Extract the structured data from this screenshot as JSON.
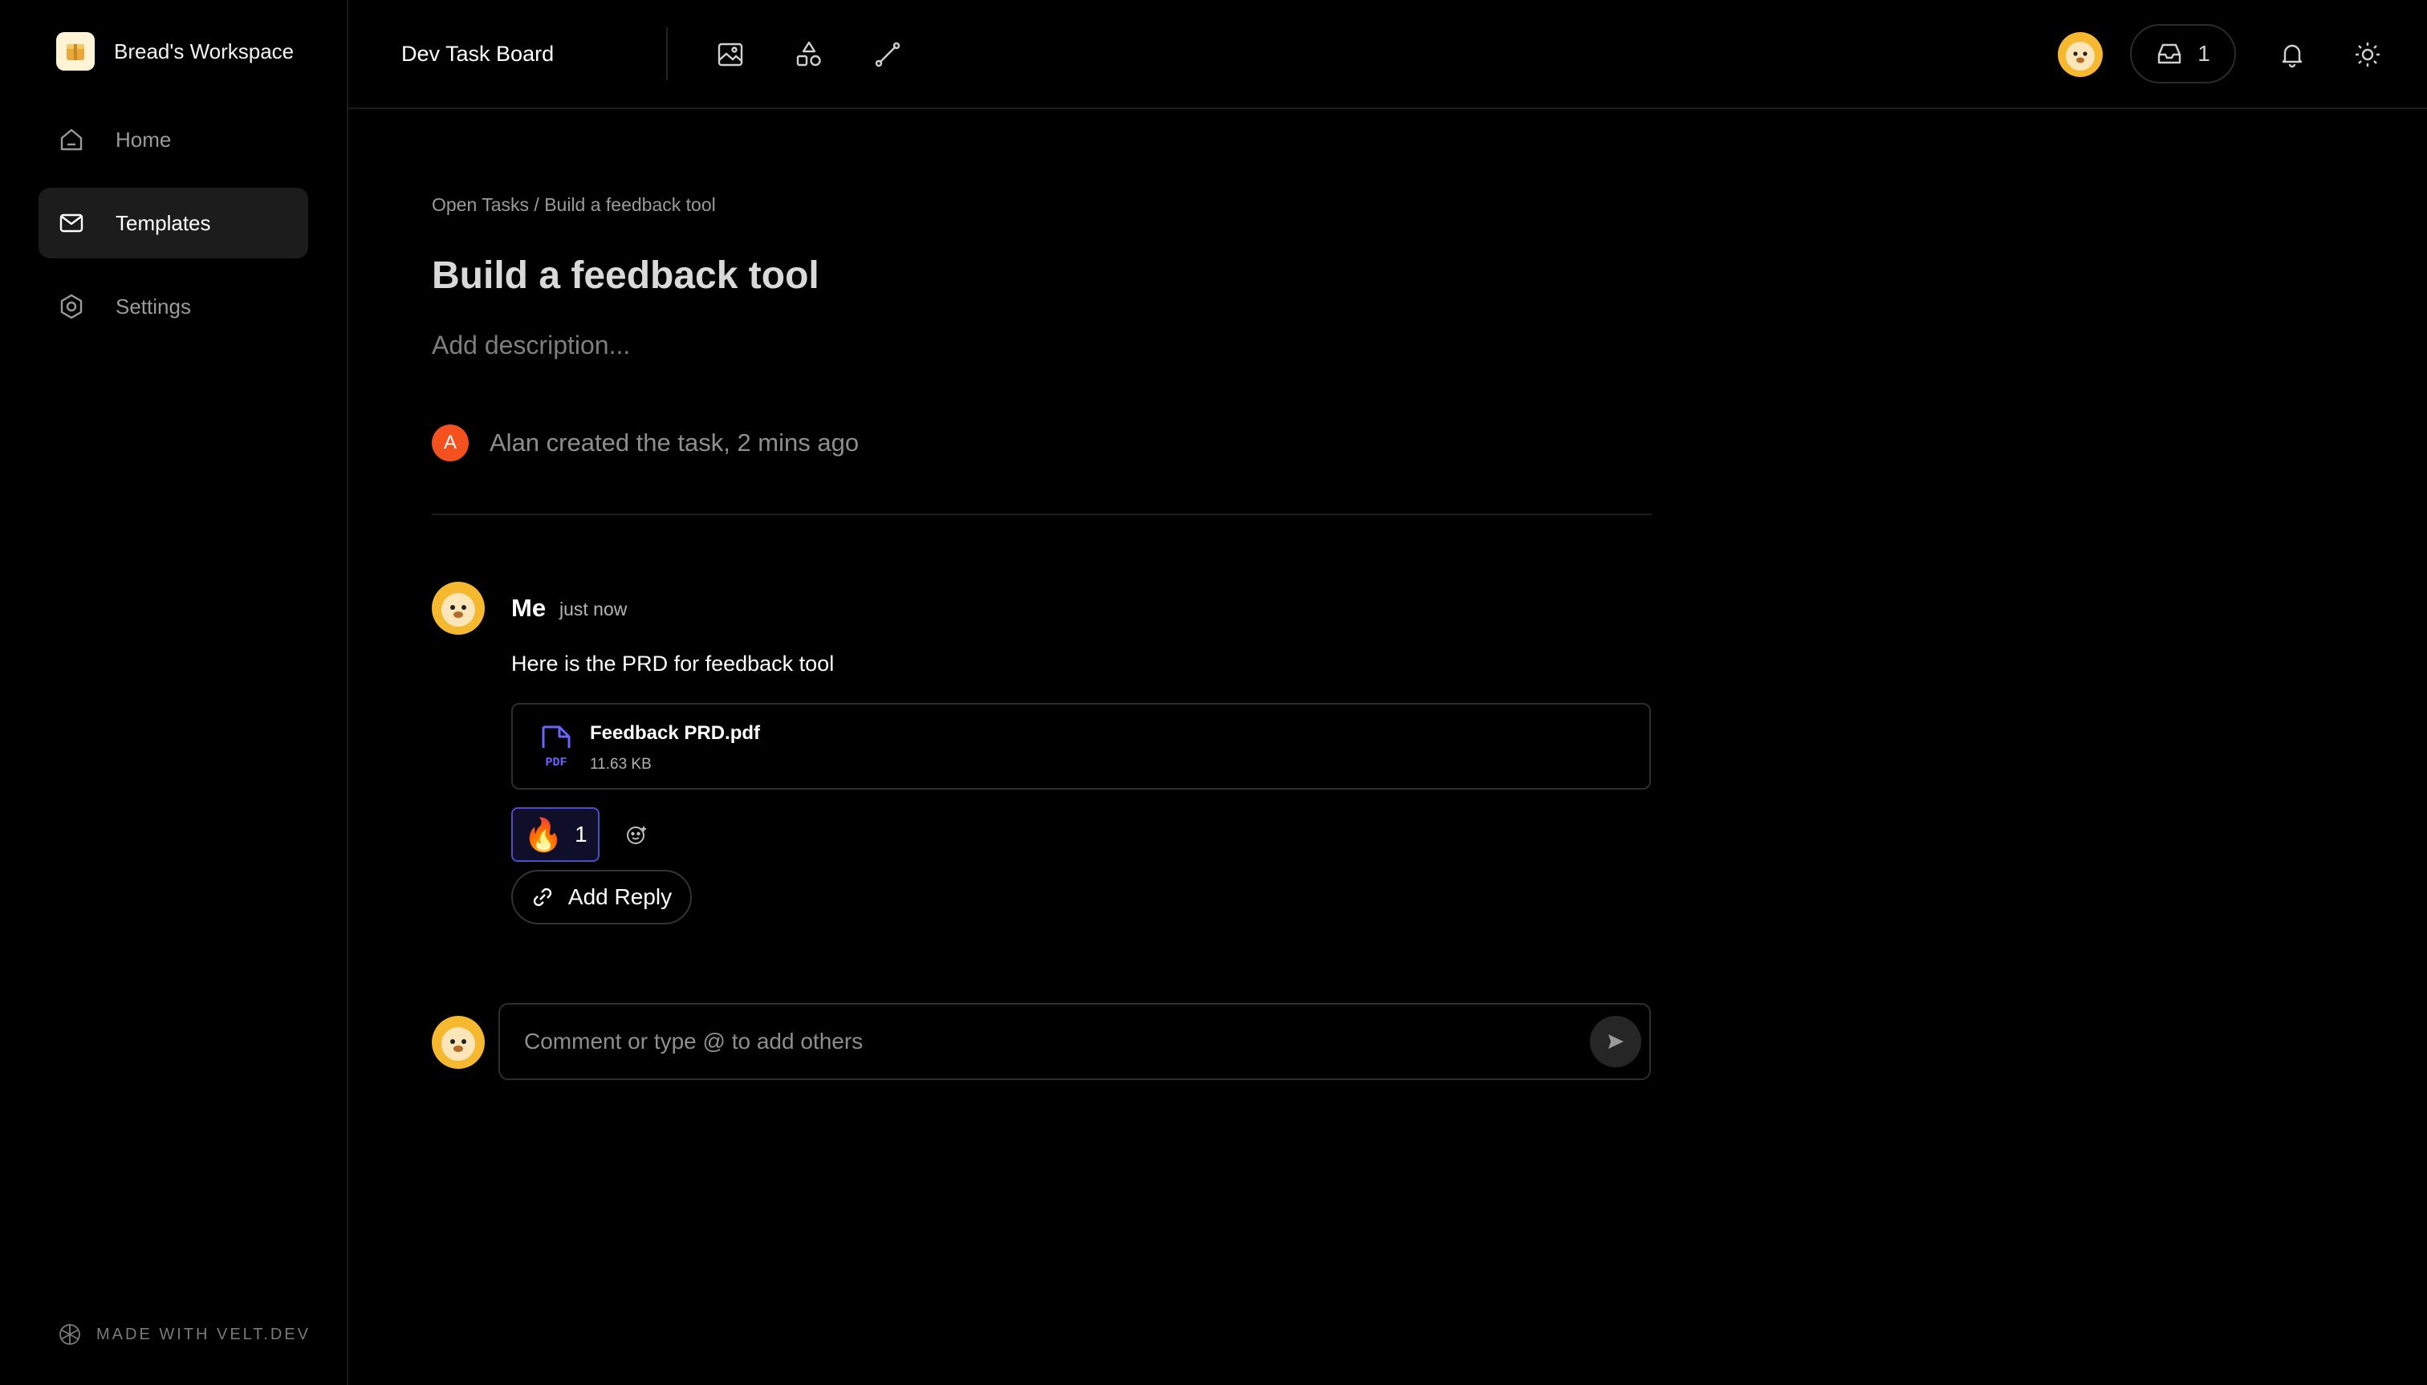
{
  "workspace": {
    "name": "Bread's Workspace"
  },
  "sidebar": {
    "items": [
      {
        "label": "Home",
        "icon": "home-icon"
      },
      {
        "label": "Templates",
        "icon": "mail-icon",
        "active": true
      },
      {
        "label": "Settings",
        "icon": "settings-icon"
      }
    ],
    "footer": "MADE WITH VELT.DEV"
  },
  "header": {
    "board_title": "Dev Task Board",
    "tools": [
      "image-icon",
      "shapes-icon",
      "line-icon"
    ],
    "inbox_count": "1",
    "icons": [
      "bell-icon",
      "sun-icon"
    ]
  },
  "task": {
    "breadcrumb": "Open Tasks / Build a feedback tool",
    "title": "Build a feedback tool",
    "description_placeholder": "Add description...",
    "activity": {
      "avatar_initial": "A",
      "text": "Alan created the task, 2 mins ago"
    }
  },
  "comment": {
    "author": "Me",
    "time": "just now",
    "body": "Here is the PRD for feedback tool",
    "attachment": {
      "name": "Feedback PRD.pdf",
      "size": "11.63 KB",
      "type_label": "PDF"
    },
    "reaction": {
      "emoji": "🔥",
      "count": "1"
    },
    "reply_label": "Add Reply"
  },
  "composer": {
    "placeholder": "Comment or type @ to add others"
  },
  "colors": {
    "background": "#000000",
    "accent": "#4e4cc9",
    "avatar_orange": "#f4511e",
    "pdf_icon": "#6b63ff"
  }
}
